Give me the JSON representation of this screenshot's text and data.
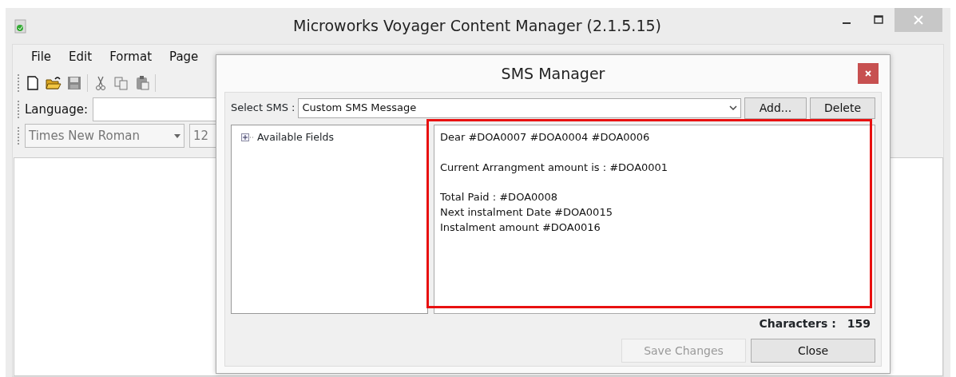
{
  "window": {
    "title": "Microworks Voyager Content Manager (2.1.5.15)"
  },
  "menu": [
    "File",
    "Edit",
    "Format",
    "Page"
  ],
  "toolbar": {
    "language_label": "Language:",
    "font": "Times New Roman",
    "size": "12"
  },
  "dialog": {
    "title": "SMS Manager",
    "select_label": "Select SMS :",
    "select_value": "Custom SMS Message",
    "buttons": [
      {
        "label": "Add..."
      },
      {
        "label": "Delete"
      }
    ],
    "tree": [
      {
        "label": "Available Fields",
        "expanded": false
      }
    ],
    "message": "Dear #DOA0007 #DOA0004 #DOA0006\n\nCurrent Arrangment amount is : #DOA0001\n\nTotal Paid : #DOA0008\nNext instalment Date #DOA0015\nInstalment amount #DOA0016",
    "highlighted": true,
    "characters_label": "Characters :",
    "characters": "159",
    "footer_buttons": [
      {
        "label": "Save Changes",
        "disabled": true
      },
      {
        "label": "Close",
        "disabled": false
      }
    ]
  }
}
